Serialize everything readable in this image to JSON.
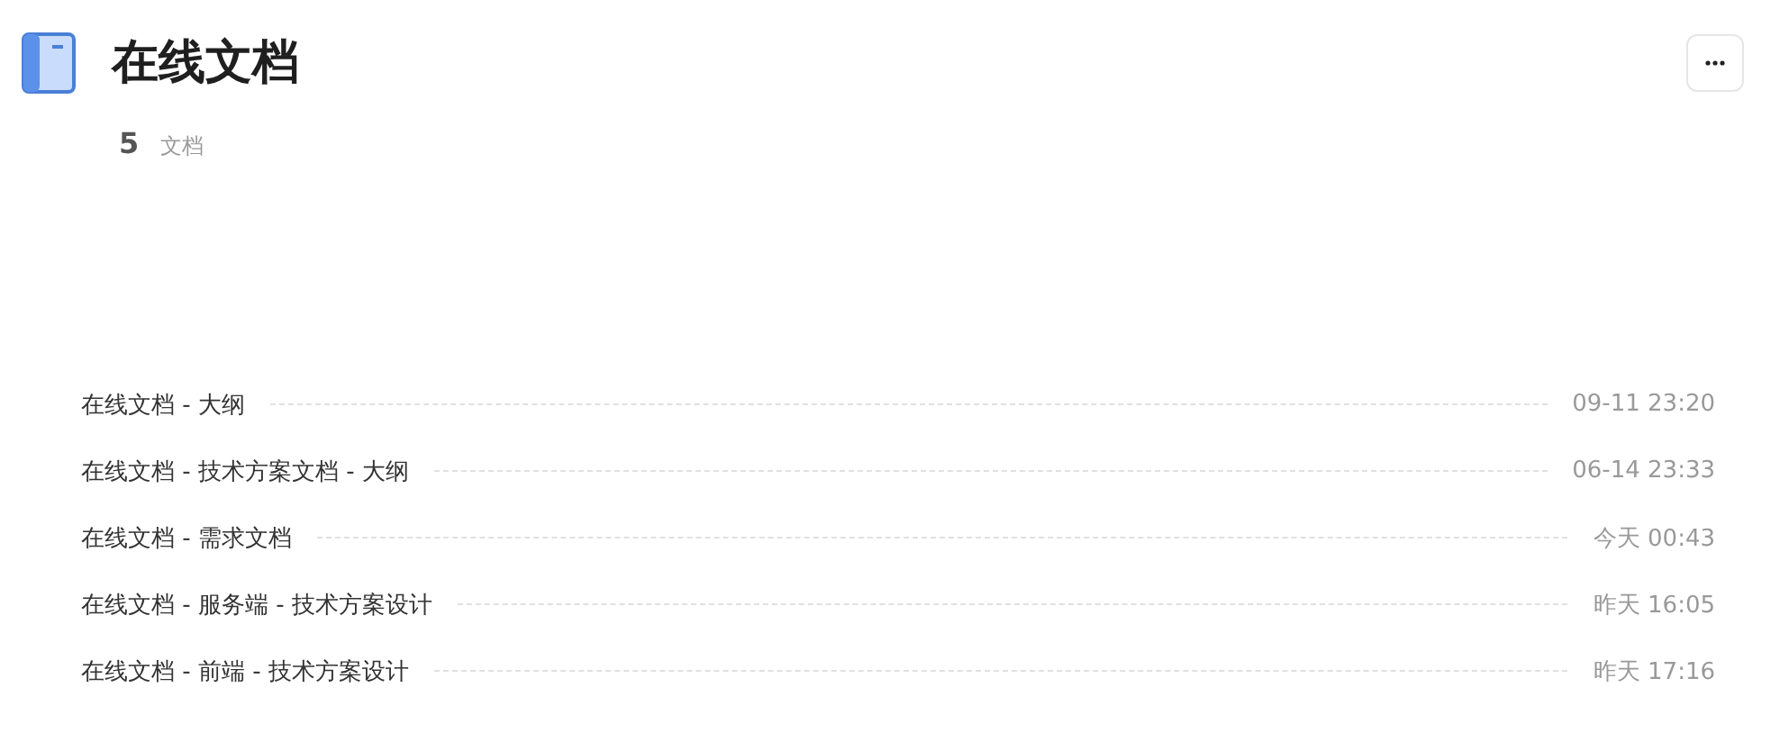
{
  "header": {
    "title": "在线文档",
    "count": "5",
    "count_label": "文档"
  },
  "documents": [
    {
      "title": "在线文档 - 大纲",
      "time": "09-11 23:20"
    },
    {
      "title": "在线文档 - 技术方案文档 - 大纲",
      "time": "06-14 23:33"
    },
    {
      "title": "在线文档 - 需求文档",
      "time": "今天 00:43"
    },
    {
      "title": "在线文档 - 服务端 - 技术方案设计",
      "time": "昨天 16:05"
    },
    {
      "title": "在线文档 - 前端 - 技术方案设计",
      "time": "昨天 17:16"
    }
  ]
}
